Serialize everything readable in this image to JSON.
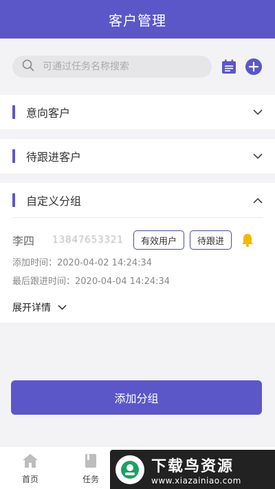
{
  "header": {
    "title": "客户管理"
  },
  "search": {
    "placeholder": "可通过任务名称搜索"
  },
  "sections": [
    {
      "title": "意向客户",
      "expanded": false
    },
    {
      "title": "待跟进客户",
      "expanded": false
    },
    {
      "title": "自定义分组",
      "expanded": true,
      "customer": {
        "name": "李四",
        "phone": "13847653321",
        "tags": [
          "有效用户",
          "待跟进"
        ],
        "added": "添加时间：2020-04-02   14:24:34",
        "last_follow": "最后跟进时间：2020-04-04   14:24:34",
        "expand_label": "展开详情"
      }
    }
  ],
  "add_group_label": "添加分组",
  "tabs": [
    {
      "label": "首页"
    },
    {
      "label": "任务"
    }
  ],
  "watermark": {
    "title": "下载鸟资源",
    "url": "www.xiazainiao.com"
  },
  "colors": {
    "primary": "#5b57c9",
    "bell": "#f5b800"
  }
}
